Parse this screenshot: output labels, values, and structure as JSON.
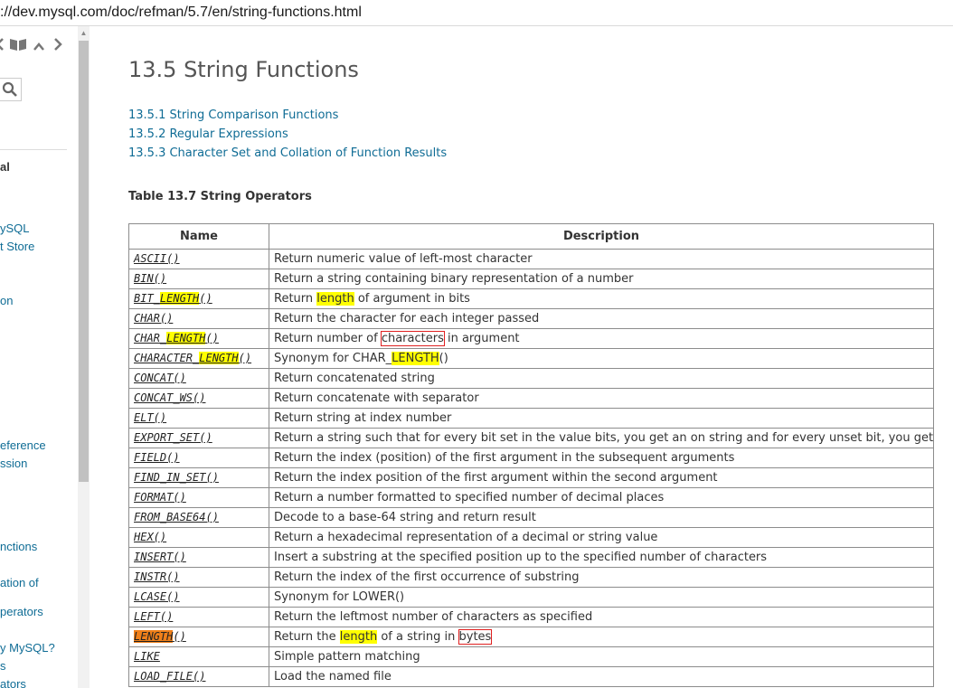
{
  "address_bar": {
    "url_visible": "://dev.mysql.com/doc/refman/5.7/en/string-functions.html"
  },
  "sidebar": {
    "icons": [
      "chevron-left-icon",
      "book-icon",
      "chevron-up-icon",
      "chevron-right-icon"
    ],
    "search_icon": "search-icon",
    "items": [
      {
        "label": "al"
      },
      {
        "label": "ySQL"
      },
      {
        "label": "t Store"
      },
      {
        "label": "on"
      },
      {
        "label": "eference"
      },
      {
        "label": "ssion"
      },
      {
        "label": "nctions"
      },
      {
        "label": "ation of"
      },
      {
        "label": "perators"
      },
      {
        "label": "y MySQL?"
      },
      {
        "label": "s"
      },
      {
        "label": "ators"
      }
    ]
  },
  "main": {
    "title": "13.5 String Functions",
    "toc": [
      "13.5.1 String Comparison Functions",
      "13.5.2 Regular Expressions",
      "13.5.3 Character Set and Collation of Function Results"
    ],
    "table_caption": "Table 13.7 String Operators",
    "table": {
      "headers": [
        "Name",
        "Description"
      ],
      "rows": [
        {
          "name": "ASCII()",
          "desc": "Return numeric value of left-most character"
        },
        {
          "name": "BIN()",
          "desc": "Return a string containing binary representation of a number"
        },
        {
          "name": "BIT_LENGTH()",
          "desc": "Return length of argument in bits"
        },
        {
          "name": "CHAR()",
          "desc": "Return the character for each integer passed"
        },
        {
          "name": "CHAR_LENGTH()",
          "desc": "Return number of characters in argument"
        },
        {
          "name": "CHARACTER_LENGTH()",
          "desc": "Synonym for CHAR_LENGTH()"
        },
        {
          "name": "CONCAT()",
          "desc": "Return concatenated string"
        },
        {
          "name": "CONCAT_WS()",
          "desc": "Return concatenate with separator"
        },
        {
          "name": "ELT()",
          "desc": "Return string at index number"
        },
        {
          "name": "EXPORT_SET()",
          "desc": "Return a string such that for every bit set in the value bits, you get an on string and for every unset bit, you get an off string"
        },
        {
          "name": "FIELD()",
          "desc": "Return the index (position) of the first argument in the subsequent arguments"
        },
        {
          "name": "FIND_IN_SET()",
          "desc": "Return the index position of the first argument within the second argument"
        },
        {
          "name": "FORMAT()",
          "desc": "Return a number formatted to specified number of decimal places"
        },
        {
          "name": "FROM_BASE64()",
          "desc": "Decode to a base-64 string and return result"
        },
        {
          "name": "HEX()",
          "desc": "Return a hexadecimal representation of a decimal or string value"
        },
        {
          "name": "INSERT()",
          "desc": "Insert a substring at the specified position up to the specified number of characters"
        },
        {
          "name": "INSTR()",
          "desc": "Return the index of the first occurrence of substring"
        },
        {
          "name": "LCASE()",
          "desc": "Synonym for LOWER()"
        },
        {
          "name": "LEFT()",
          "desc": "Return the leftmost number of characters as specified"
        },
        {
          "name": "LENGTH()",
          "desc": "Return the length of a string in bytes"
        },
        {
          "name": "LIKE",
          "desc": "Simple pattern matching"
        },
        {
          "name": "LOAD_FILE()",
          "desc": "Load the named file"
        }
      ]
    }
  },
  "colors": {
    "link": "#0f6c95",
    "highlight_yellow": "#ffff00",
    "highlight_orange": "#f0801a",
    "annotation_box": "#e02020"
  }
}
